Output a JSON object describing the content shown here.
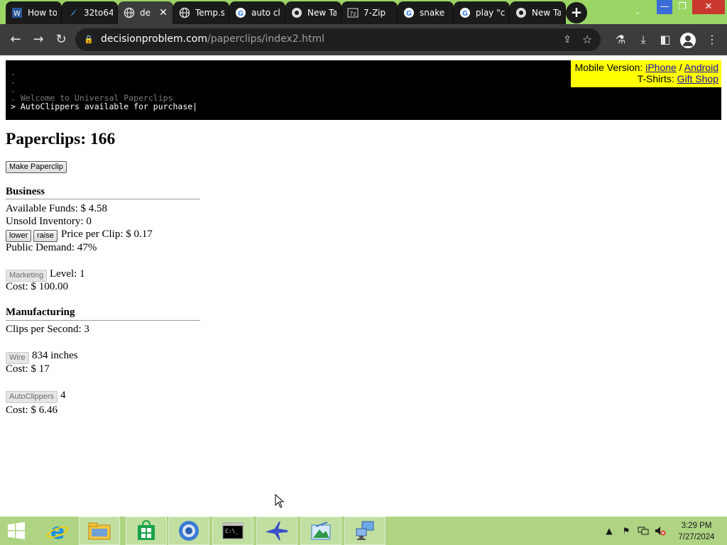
{
  "browser": {
    "tabs": [
      {
        "title": "How to",
        "icon": "word-icon"
      },
      {
        "title": "32to64",
        "icon": "feather-icon"
      },
      {
        "title": "de",
        "icon": "globe-icon",
        "active": true
      },
      {
        "title": "Temp.s",
        "icon": "globe-icon"
      },
      {
        "title": "auto cl",
        "icon": "google-icon"
      },
      {
        "title": "New Ta",
        "icon": "chrome-icon"
      },
      {
        "title": "7-Zip",
        "icon": "7zip-icon"
      },
      {
        "title": "snake",
        "icon": "google-icon"
      },
      {
        "title": "play \"cl",
        "icon": "google-icon"
      },
      {
        "title": "New Ta",
        "icon": "chrome-icon"
      }
    ],
    "new_tab_label": "+",
    "url_domain": "decisionproblem.com",
    "url_path": "/paperclips/index2.html"
  },
  "console": {
    "lines": [
      ".",
      ".",
      ".",
      ". Welcome to Universal Paperclips"
    ],
    "current": "> AutoClippers available for purchase|"
  },
  "promo": {
    "mobile_label": "Mobile Version: ",
    "iphone": "iPhone",
    "separator": " / ",
    "android": "Android",
    "tshirts_label": "T-Shirts: ",
    "gift_shop": "Gift Shop"
  },
  "game": {
    "paperclips_label": "Paperclips: ",
    "paperclips": "166",
    "make_button": "Make Paperclip",
    "business": {
      "heading": "Business",
      "funds_label": "Available Funds: $ ",
      "funds": "4.58",
      "inventory_label": "Unsold Inventory: ",
      "inventory": "0",
      "lower_button": "lower",
      "raise_button": "raise",
      "price_label": "Price per Clip: $ ",
      "price": "0.17",
      "demand_label": "Public Demand: ",
      "demand": "47%",
      "marketing_button": "Marketing",
      "level_label": "Level: ",
      "level": "1",
      "marketing_cost_label": "Cost: $ ",
      "marketing_cost": "100.00"
    },
    "manufacturing": {
      "heading": "Manufacturing",
      "cps_label": "Clips per Second: ",
      "cps": "3",
      "wire_button": "Wire",
      "wire": "834 inches",
      "wire_cost_label": "Cost: $ ",
      "wire_cost": "17",
      "autoclippers_button": "AutoClippers",
      "autoclippers": "4",
      "autoclippers_cost_label": "Cost: $ ",
      "autoclippers_cost": "6.46"
    }
  },
  "taskbar": {
    "time": "3:29 PM",
    "date": "7/27/2024"
  }
}
